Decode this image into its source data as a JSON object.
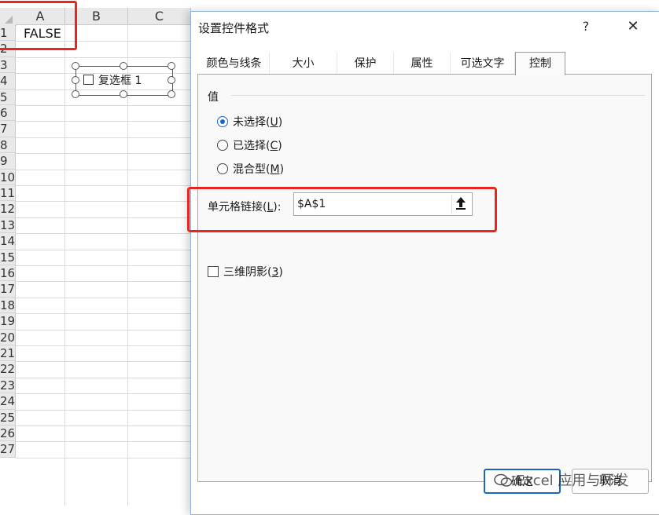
{
  "sheet": {
    "columns": [
      "A",
      "B",
      "C"
    ],
    "rows": [
      "1",
      "2",
      "3",
      "4",
      "5",
      "6",
      "7",
      "8",
      "9",
      "10",
      "11",
      "12",
      "13",
      "14",
      "15",
      "16",
      "17",
      "18",
      "19",
      "20",
      "21",
      "22",
      "23",
      "24",
      "25",
      "26",
      "27"
    ],
    "cell_a1": "FALSE",
    "form_checkbox_label": "复选框 1"
  },
  "dialog": {
    "title": "设置控件格式",
    "help": "?",
    "close": "✕",
    "tabs": [
      "颜色与线条",
      "大小",
      "保护",
      "属性",
      "可选文字",
      "控制"
    ],
    "active_tab": "控制",
    "group_label": "值",
    "radios": [
      {
        "label": "未选择(",
        "key": "U",
        "end": ")",
        "checked": true
      },
      {
        "label": "已选择(",
        "key": "C",
        "end": ")",
        "checked": false
      },
      {
        "label": "混合型(",
        "key": "M",
        "end": ")",
        "checked": false
      }
    ],
    "link": {
      "label": "单元格链接(",
      "key": "L",
      "end": "):",
      "value": "$A$1"
    },
    "shadow": {
      "label": "三维阴影(",
      "key": "3",
      "end": ")",
      "checked": false
    },
    "ok": "确定",
    "cancel": "取消"
  },
  "watermark": "Excel 应用与开发",
  "colors": {
    "accent": "#1a66c2",
    "highlight": "#e8251f"
  }
}
